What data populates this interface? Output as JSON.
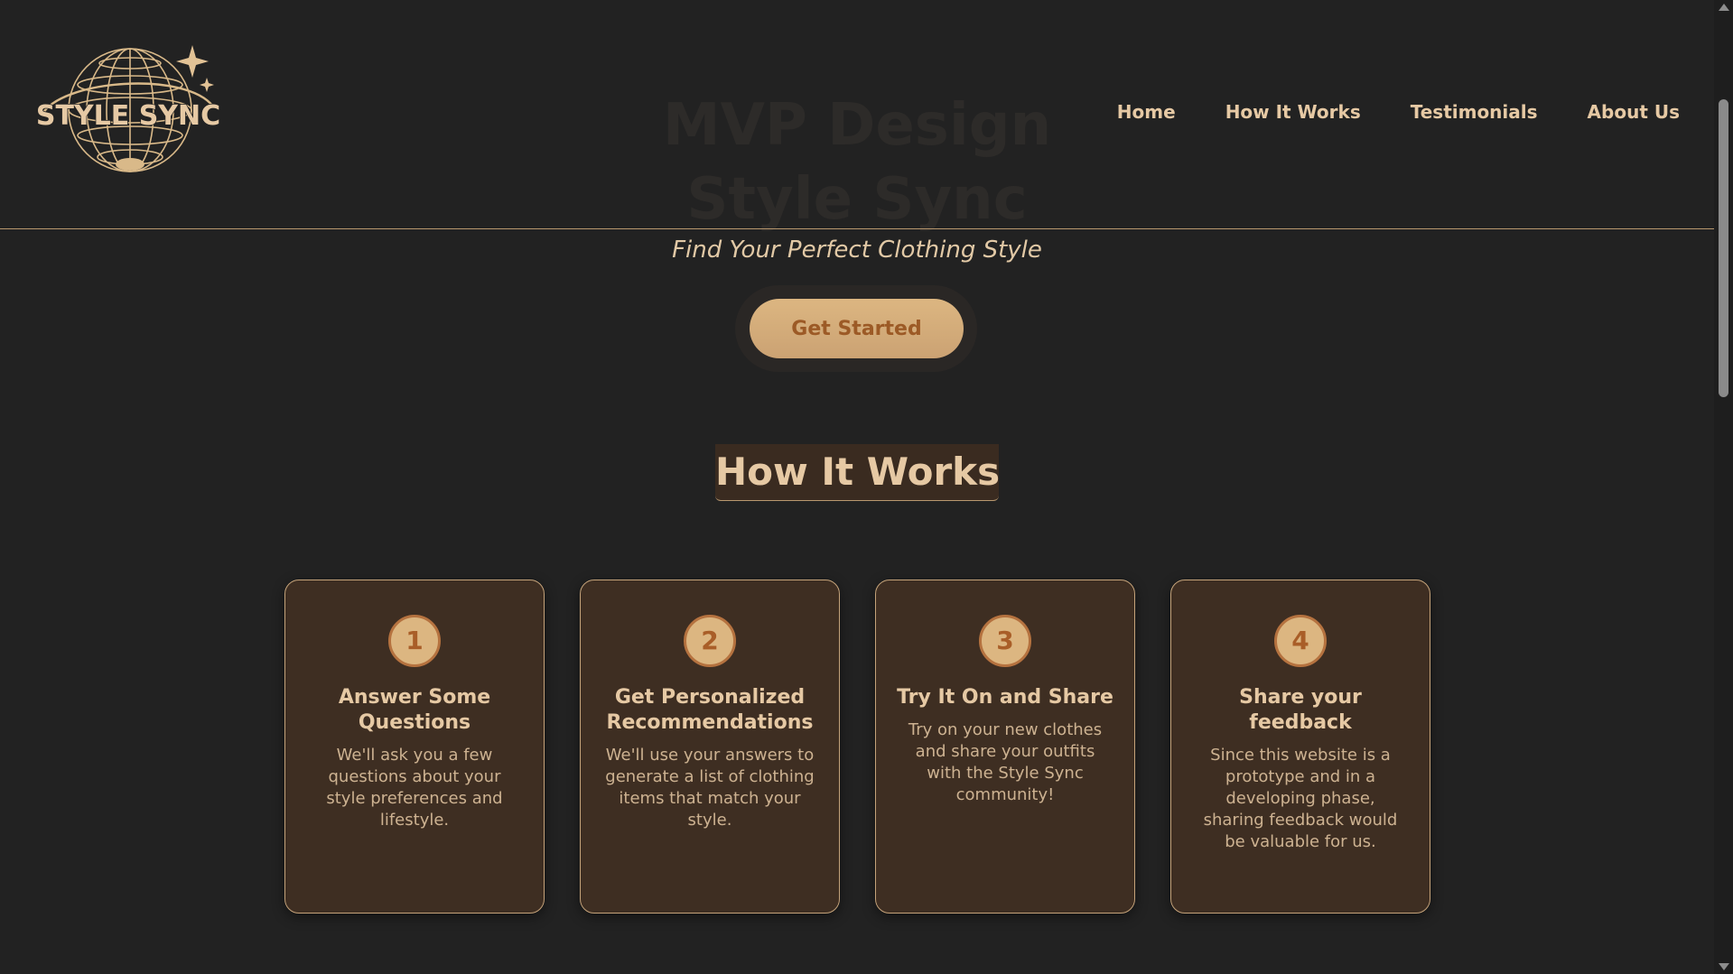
{
  "hero": {
    "title": "MVP Design\nStyle Sync",
    "tagline": "Find Your Perfect Clothing Style",
    "cta_label": "Get Started"
  },
  "header": {
    "logo_text": "STYLE SYNC",
    "nav": [
      {
        "label": "Home"
      },
      {
        "label": "How It Works"
      },
      {
        "label": "Testimonials"
      },
      {
        "label": "About Us"
      }
    ]
  },
  "how_it_works": {
    "title": "How It Works",
    "steps": [
      {
        "number": "1",
        "title": "Answer Some Questions",
        "text": "We'll ask you a few questions about your style preferences and lifestyle."
      },
      {
        "number": "2",
        "title": "Get Personalized Recommendations",
        "text": "We'll use your answers to generate a list of clothing items that match your style."
      },
      {
        "number": "3",
        "title": "Try It On and Share",
        "text": "Try on your new clothes and share your outfits with the Style Sync community!"
      },
      {
        "number": "4",
        "title": "Share your feedback",
        "text": "Since this website is a prototype and in a developing phase, sharing feedback would be valuable for us."
      }
    ]
  },
  "colors": {
    "background": "#222222",
    "accent": "#dcb681",
    "card_bg": "#3e2e22",
    "text": "#e6c9a4"
  }
}
